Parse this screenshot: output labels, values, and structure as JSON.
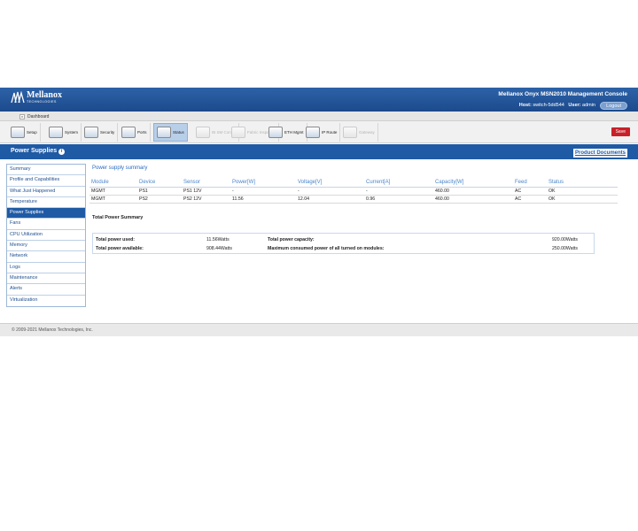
{
  "header": {
    "logo_name": "Mellanox",
    "logo_sub": "TECHNOLOGIES",
    "console_title": "Mellanox Onyx MSN2010 Management Console",
    "host_label": "Host:",
    "host_value": "switch-5dd544",
    "user_label": "User:",
    "user_value": "admin",
    "logout": "Logout",
    "colors": {
      "header_bg": "#1f5aa5",
      "save": "#c8202a"
    }
  },
  "dashbar": {
    "tab_label": "Dashboard",
    "close": "x"
  },
  "toolbar": {
    "items": [
      {
        "label": "Setup",
        "icon": "setup-icon",
        "enabled": true,
        "active": false
      },
      {
        "label": "System",
        "icon": "system-icon",
        "enabled": true,
        "active": false
      },
      {
        "label": "Security",
        "icon": "security-icon",
        "enabled": true,
        "active": false
      },
      {
        "label": "Ports",
        "icon": "ports-icon",
        "enabled": true,
        "active": false
      },
      {
        "label": "Status",
        "icon": "status-icon",
        "enabled": true,
        "active": true
      },
      {
        "label": "IB SM Config",
        "icon": "ib-sm-icon",
        "enabled": false,
        "active": false
      },
      {
        "label": "Fabric Inspector",
        "icon": "fabric-icon",
        "enabled": false,
        "active": false
      },
      {
        "label": "ETH Mgmt",
        "icon": "eth-mgmt-icon",
        "enabled": true,
        "active": false
      },
      {
        "label": "IP Route",
        "icon": "ip-route-icon",
        "enabled": true,
        "active": false
      },
      {
        "label": "Gateway",
        "icon": "gateway-icon",
        "enabled": false,
        "active": false
      }
    ],
    "save": "Save"
  },
  "section": {
    "title": "Power Supplies",
    "product_docs": "Product Documents"
  },
  "sidebar": {
    "items": [
      "Summary",
      "Profile and Capabilities",
      "What Just Happened",
      "Temperature",
      "Power Supplies",
      "Fans",
      "CPU Utilization",
      "Memory",
      "Network",
      "Logs",
      "Maintenance",
      "Alerts",
      "Virtualization"
    ],
    "active_index": 4
  },
  "power": {
    "subtitle": "Power supply summary",
    "columns": [
      "Module",
      "Device",
      "Sensor",
      "Power[W]",
      "Voltage[V]",
      "Current[A]",
      "Capacity[W]",
      "Feed",
      "Status"
    ],
    "rows": [
      [
        "MGMT",
        "PS1",
        "PS1 12V",
        "-",
        "-",
        "-",
        "460.00",
        "AC",
        "OK"
      ],
      [
        "MGMT",
        "PS2",
        "PS2 12V",
        "11.56",
        "12.04",
        "0.96",
        "460.00",
        "AC",
        "OK"
      ]
    ]
  },
  "total": {
    "title": "Total Power Summary",
    "used_label": "Total power used:",
    "used_value": "11.56Watts",
    "available_label": "Total power available:",
    "available_value": "908.44Watts",
    "capacity_label": "Total power capacity:",
    "capacity_value": "920.00Watts",
    "max_label": "Maximum consumed power of all turned on modules:",
    "max_value": "250.00Watts"
  },
  "footer": {
    "copyright": "© 2009-2021 Mellanox Technologies, Inc."
  }
}
